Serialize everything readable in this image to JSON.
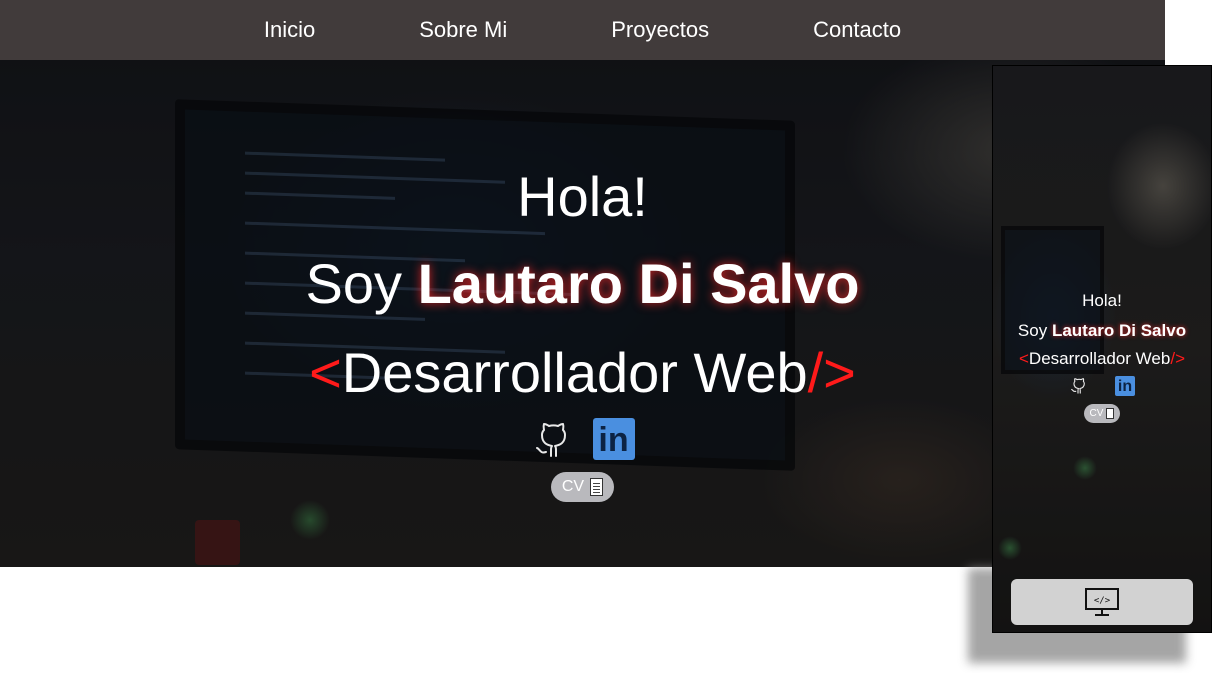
{
  "nav": {
    "items": [
      {
        "label": "Inicio"
      },
      {
        "label": "Sobre Mi"
      },
      {
        "label": "Proyectos"
      },
      {
        "label": "Contacto"
      }
    ]
  },
  "hero": {
    "greeting": "Hola!",
    "intro": "Soy",
    "name": "Lautaro Di Salvo",
    "bracket_open": "<",
    "role": "Desarrollador Web",
    "bracket_close": "/>",
    "cv_label": "CV"
  },
  "icons": {
    "github": "github-icon",
    "linkedin": "linkedin-icon",
    "document": "document-icon",
    "code_monitor": "code-monitor-icon"
  },
  "linkedin_glyph": "in",
  "colors": {
    "nav_bg": "#413b3b",
    "accent_red": "#ff1a1a",
    "linkedin_blue": "#4a8fe0",
    "cv_button_bg": "#b9b9bd"
  }
}
